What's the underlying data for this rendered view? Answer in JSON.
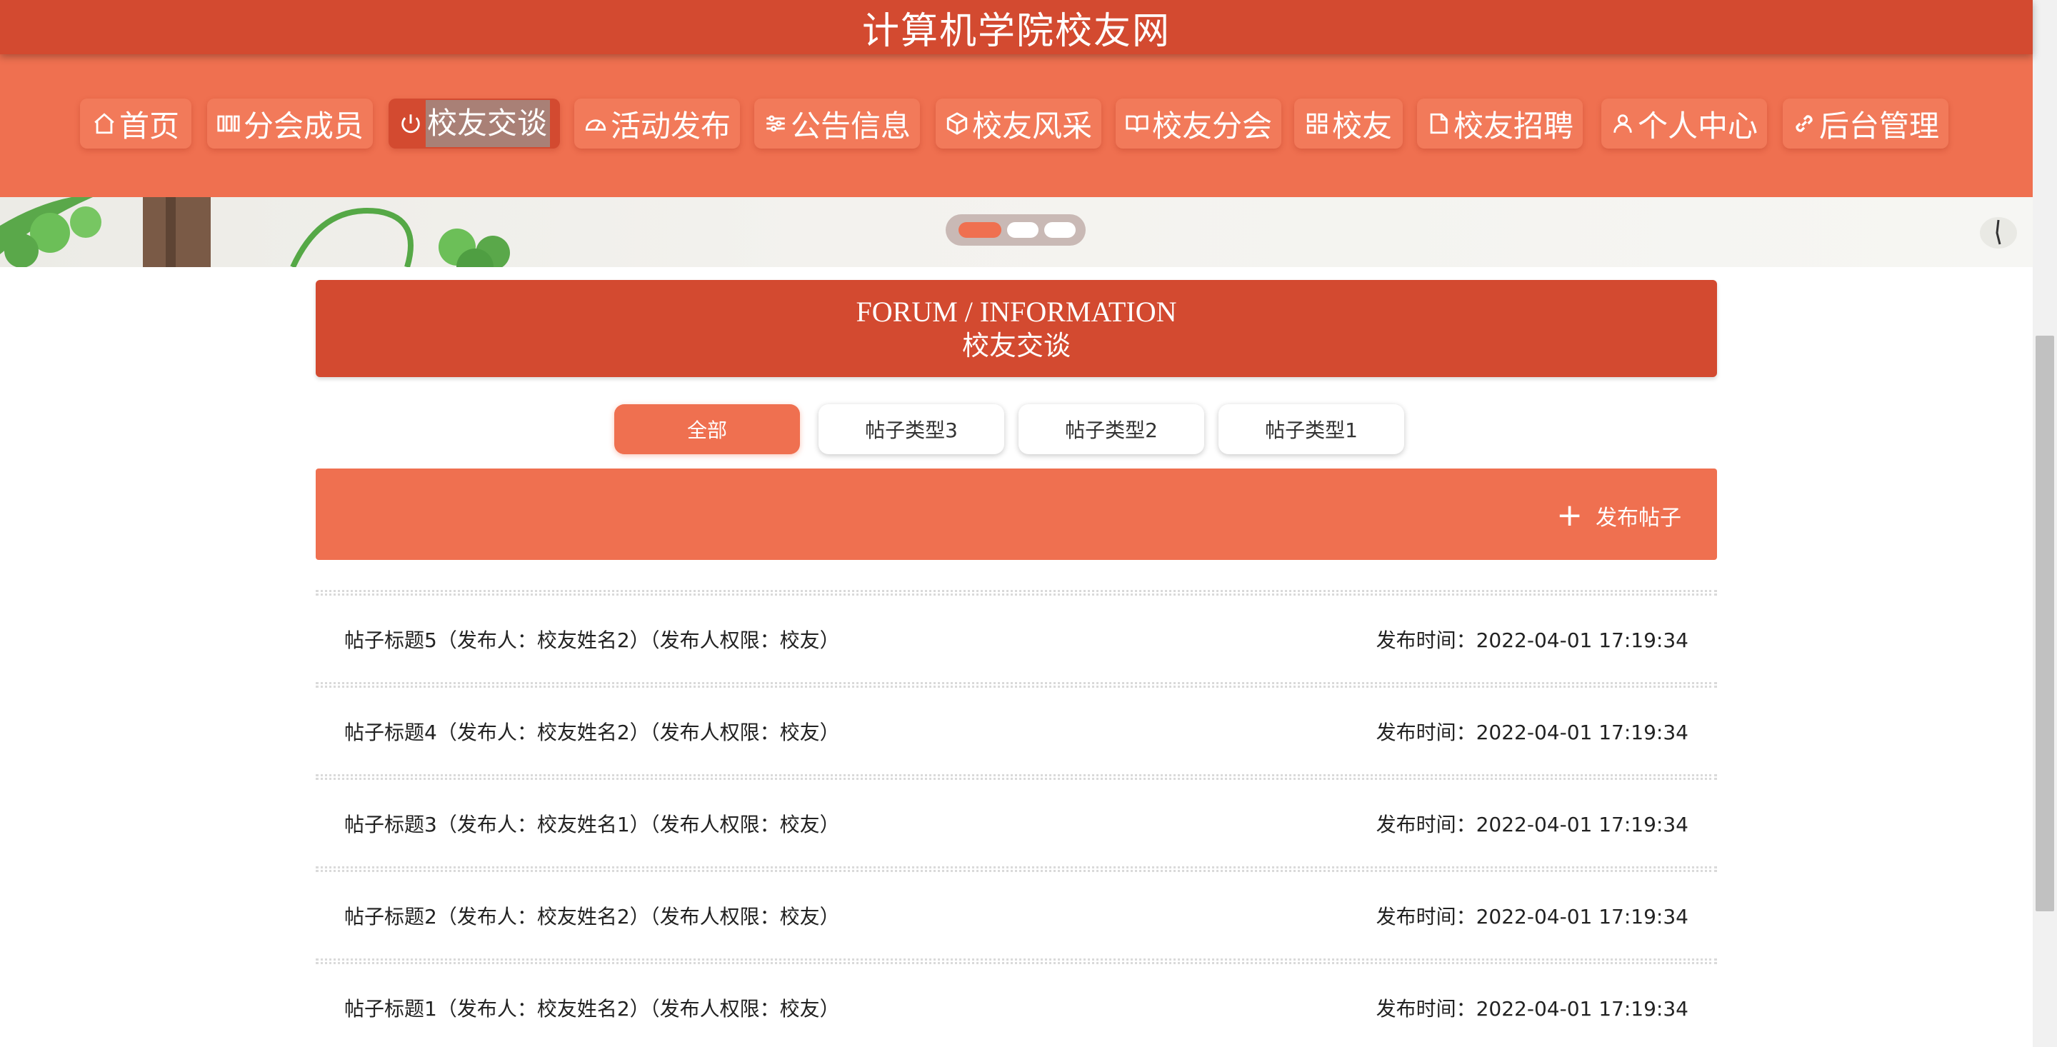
{
  "site": {
    "title": "计算机学院校友网"
  },
  "nav": {
    "items": [
      {
        "label": "首页",
        "icon": "home-icon"
      },
      {
        "label": "分会成员",
        "icon": "members-icon"
      },
      {
        "label": "校友交谈",
        "icon": "power-icon",
        "active": true
      },
      {
        "label": "活动发布",
        "icon": "gauge-icon"
      },
      {
        "label": "公告信息",
        "icon": "sliders-icon"
      },
      {
        "label": "校友风采",
        "icon": "cube-icon"
      },
      {
        "label": "校友分会",
        "icon": "book-icon"
      },
      {
        "label": "校友",
        "icon": "grid-icon"
      },
      {
        "label": "校友招聘",
        "icon": "document-icon"
      },
      {
        "label": "个人中心",
        "icon": "user-icon"
      },
      {
        "label": "后台管理",
        "icon": "link-icon"
      }
    ]
  },
  "banner": {
    "active_slide": 1,
    "slide_count": 3
  },
  "section": {
    "title_en": "FORUM / INFORMATION",
    "title_cn": "校友交谈"
  },
  "filters": [
    {
      "label": "全部",
      "active": true
    },
    {
      "label": "帖子类型3"
    },
    {
      "label": "帖子类型2"
    },
    {
      "label": "帖子类型1"
    }
  ],
  "actions": {
    "publish_label": "发布帖子",
    "publish_icon": "plus-icon"
  },
  "posts": [
    {
      "title": "帖子标题5（发布人：校友姓名2）（发布人权限：校友）",
      "time": "发布时间：2022-04-01 17:19:34"
    },
    {
      "title": "帖子标题4（发布人：校友姓名2）（发布人权限：校友）",
      "time": "发布时间：2022-04-01 17:19:34"
    },
    {
      "title": "帖子标题3（发布人：校友姓名1）（发布人权限：校友）",
      "time": "发布时间：2022-04-01 17:19:34"
    },
    {
      "title": "帖子标题2（发布人：校友姓名2）（发布人权限：校友）",
      "time": "发布时间：2022-04-01 17:19:34"
    },
    {
      "title": "帖子标题1（发布人：校友姓名2）（发布人权限：校友）",
      "time": "发布时间：2022-04-01 17:19:34"
    }
  ],
  "colors": {
    "primary_dark": "#d34a30",
    "primary": "#ef7050",
    "nav_button": "#f27a5a"
  }
}
